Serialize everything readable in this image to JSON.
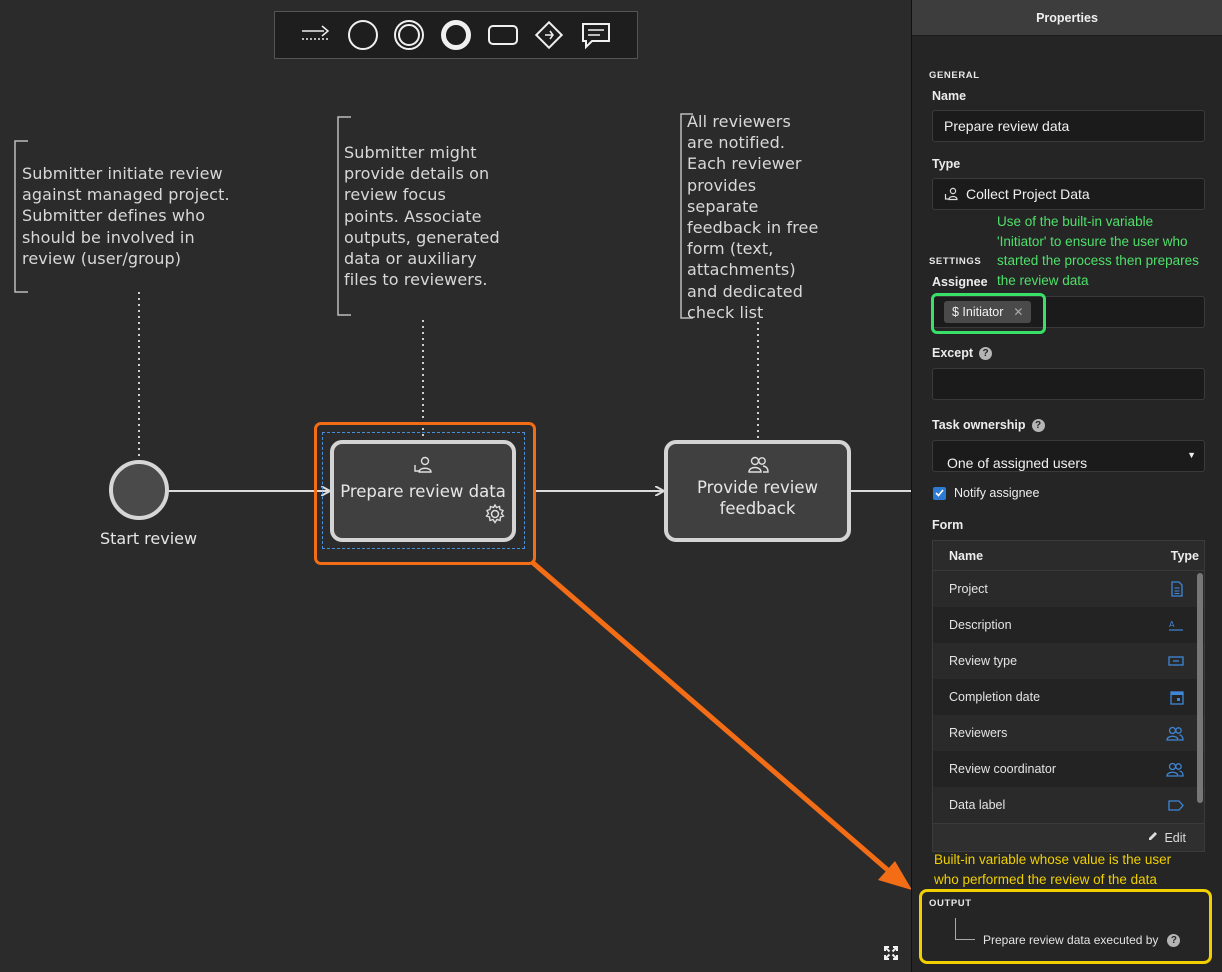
{
  "toolbar": {
    "tools": [
      "connector-icon",
      "start-event-icon",
      "intermediate-event-icon",
      "end-event-icon",
      "task-icon",
      "gateway-icon",
      "annotation-icon"
    ]
  },
  "diagram": {
    "annotations": [
      [
        "Submitter initiate review",
        "against managed project.",
        "Submitter defines who",
        "should be involved in",
        "review (user/group)"
      ],
      [
        "Submitter might",
        "provide details on",
        "review focus",
        "points. Associate",
        "outputs, generated",
        "data or auxiliary",
        "files to reviewers."
      ],
      [
        "All reviewers",
        "are notified.",
        "Each reviewer",
        "provides",
        "separate",
        "feedback in free",
        "form (text,",
        "attachments)",
        "and dedicated",
        "check list"
      ]
    ],
    "start_event_label": "Start review",
    "task_prepare": "Prepare review data",
    "task_feedback_lines": [
      "Provide review",
      "feedback"
    ]
  },
  "panel": {
    "title": "Properties",
    "general_title": "GENERAL",
    "name_label": "Name",
    "name_value": "Prepare review data",
    "type_label": "Type",
    "type_value": "Collect Project Data",
    "settings_title": "SETTINGS",
    "assignee_label": "Assignee",
    "assignee_chip": "$ Initiator",
    "except_label": "Except",
    "ownership_label": "Task ownership",
    "ownership_value": "One of assigned users",
    "notify_label": "Notify assignee",
    "form_label": "Form",
    "form_columns": [
      "Name",
      "Type"
    ],
    "form_rows": [
      {
        "name": "Project",
        "icon": "document-icon"
      },
      {
        "name": "Description",
        "icon": "text-field-icon"
      },
      {
        "name": "Review type",
        "icon": "dropdown-field-icon"
      },
      {
        "name": "Completion date",
        "icon": "calendar-icon"
      },
      {
        "name": "Reviewers",
        "icon": "users-icon"
      },
      {
        "name": "Review coordinator",
        "icon": "users-icon"
      },
      {
        "name": "Data label",
        "icon": "tag-icon"
      }
    ],
    "edit_label": "Edit",
    "output_title": "OUTPUT",
    "output_item": "Prepare review data executed by"
  },
  "callouts": {
    "green_lines": [
      "Use of the built-in variable",
      "'Initiator' to ensure the user who",
      "started the process then prepares",
      "the review data"
    ],
    "yellow_lines": [
      "Built-in variable whose value is the user",
      "who performed the review of the data"
    ],
    "green_color": "#4fe06a",
    "yellow_color": "#f0d000",
    "arrow_color": "#f36d17"
  }
}
